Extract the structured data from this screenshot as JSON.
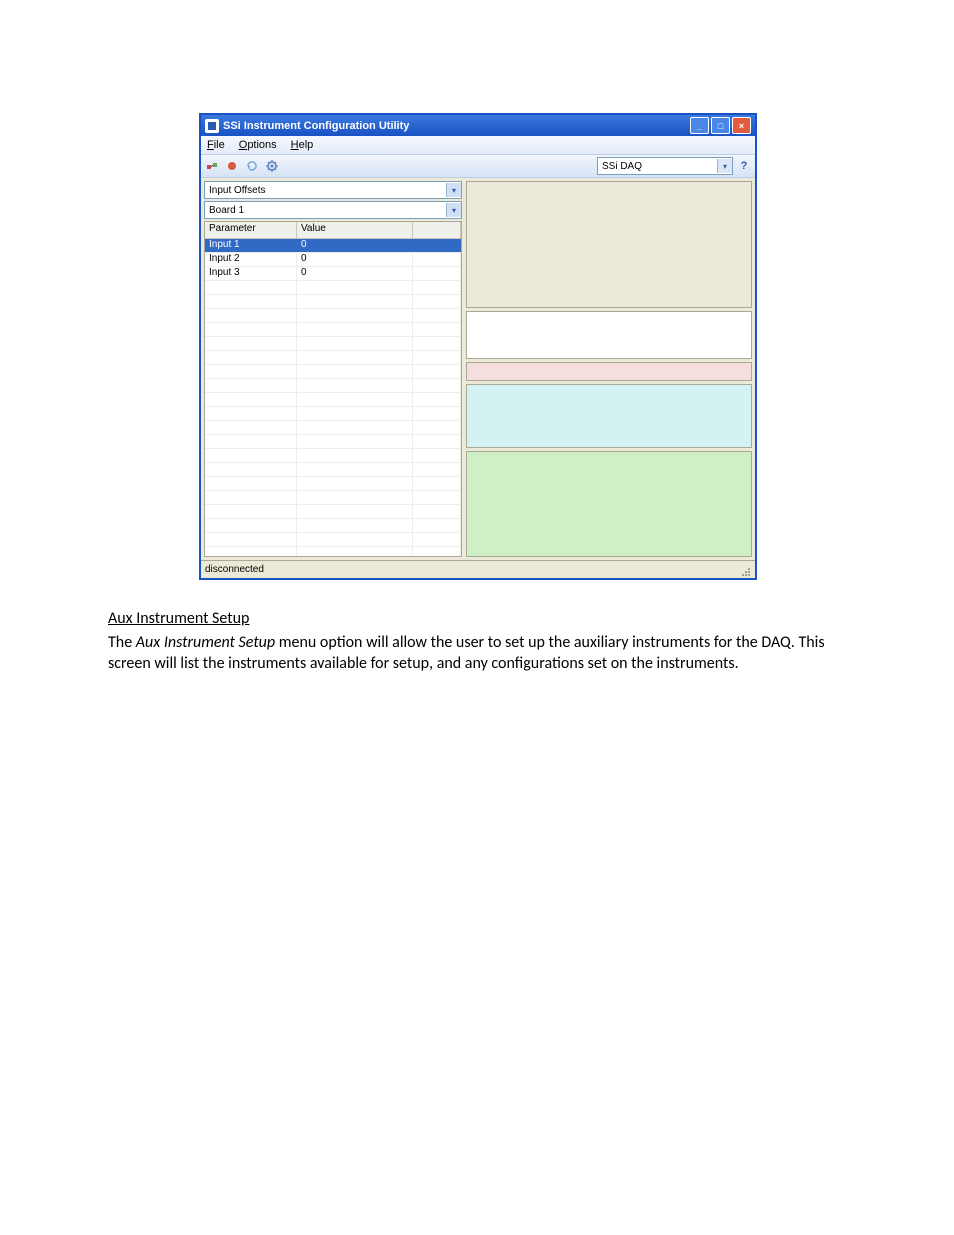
{
  "window": {
    "title": "SSi Instrument Configuration Utility",
    "minimize_label": "_",
    "maximize_label": "□",
    "close_label": "×"
  },
  "menubar": {
    "file": "File",
    "options": "Options",
    "help": "Help"
  },
  "toolbar": {
    "select_value": "SSi DAQ",
    "help_label": "?"
  },
  "left": {
    "combo1": "Input Offsets",
    "combo2": "Board 1",
    "header_param": "Parameter",
    "header_value": "Value",
    "rows": [
      {
        "param": "Input 1",
        "value": "0",
        "selected": true
      },
      {
        "param": "Input 2",
        "value": "0",
        "selected": false
      },
      {
        "param": "Input 3",
        "value": "0",
        "selected": false
      }
    ]
  },
  "status": {
    "text": "disconnected"
  },
  "doc": {
    "heading": "Aux Instrument  Setup",
    "italic_phrase": "Aux Instrument Setup",
    "body_prefix": "The ",
    "body_suffix": " menu option will allow the user to set up the auxiliary instruments for the DAQ.  This screen will list the instruments available for setup, and any configurations set on the instruments."
  }
}
